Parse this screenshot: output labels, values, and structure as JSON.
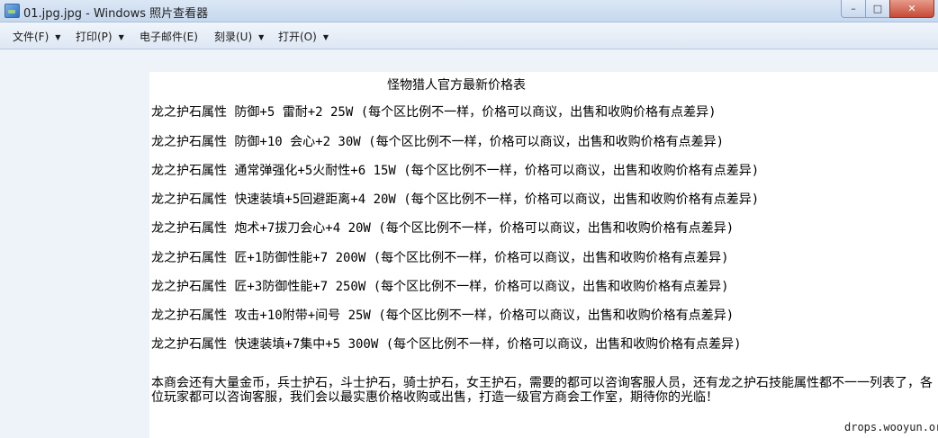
{
  "window": {
    "title": "01.jpg.jpg - Windows 照片查看器",
    "minimize_glyph": "–",
    "maximize_glyph": "□",
    "close_glyph": "✕"
  },
  "menu": {
    "items": [
      {
        "label": "文件(F)",
        "has_dropdown": true
      },
      {
        "label": "打印(P)",
        "has_dropdown": true
      },
      {
        "label": "电子邮件(E)",
        "has_dropdown": false
      },
      {
        "label": "刻录(U)",
        "has_dropdown": true
      },
      {
        "label": "打开(O)",
        "has_dropdown": true
      }
    ],
    "dropdown_glyph": "▼"
  },
  "image": {
    "title": "怪物猎人官方最新价格表",
    "rows": [
      "龙之护石属性 防御+5 雷耐+2  25W (每个区比例不一样，价格可以商议，出售和收购价格有点差异)",
      "龙之护石属性 防御+10 会心+2 30W  (每个区比例不一样，价格可以商议，出售和收购价格有点差异)",
      "龙之护石属性 通常弹强化+5火耐性+6 15W (每个区比例不一样，价格可以商议，出售和收购价格有点差异)",
      "龙之护石属性 快速装填+5回避距离+4 20W  (每个区比例不一样，价格可以商议，出售和收购价格有点差异)",
      "龙之护石属性 炮术+7拔刀会心+4 20W   (每个区比例不一样，价格可以商议，出售和收购价格有点差异)",
      "龙之护石属性 匠+1防御性能+7 200W    (每个区比例不一样，价格可以商议，出售和收购价格有点差异)",
      "龙之护石属性 匠+3防御性能+7 250W    (每个区比例不一样，价格可以商议，出售和收购价格有点差异)",
      "龙之护石属性 攻击+10附带+间号 25W   (每个区比例不一样，价格可以商议，出售和收购价格有点差异)",
      "龙之护石属性 快速装填+7集中+5 300W  (每个区比例不一样，价格可以商议，出售和收购价格有点差异)"
    ],
    "note": "本商会还有大量金币，兵士护石，斗士护石，骑士护石，女王护石，需要的都可以咨询客服人员，还有龙之护石技能属性都不一一列表了，各位玩家都可以咨询客服，我们会以最实惠价格收购或出售，打造一级官方商会工作室，期待你的光临！",
    "watermark": "drops.wooyun.org"
  }
}
